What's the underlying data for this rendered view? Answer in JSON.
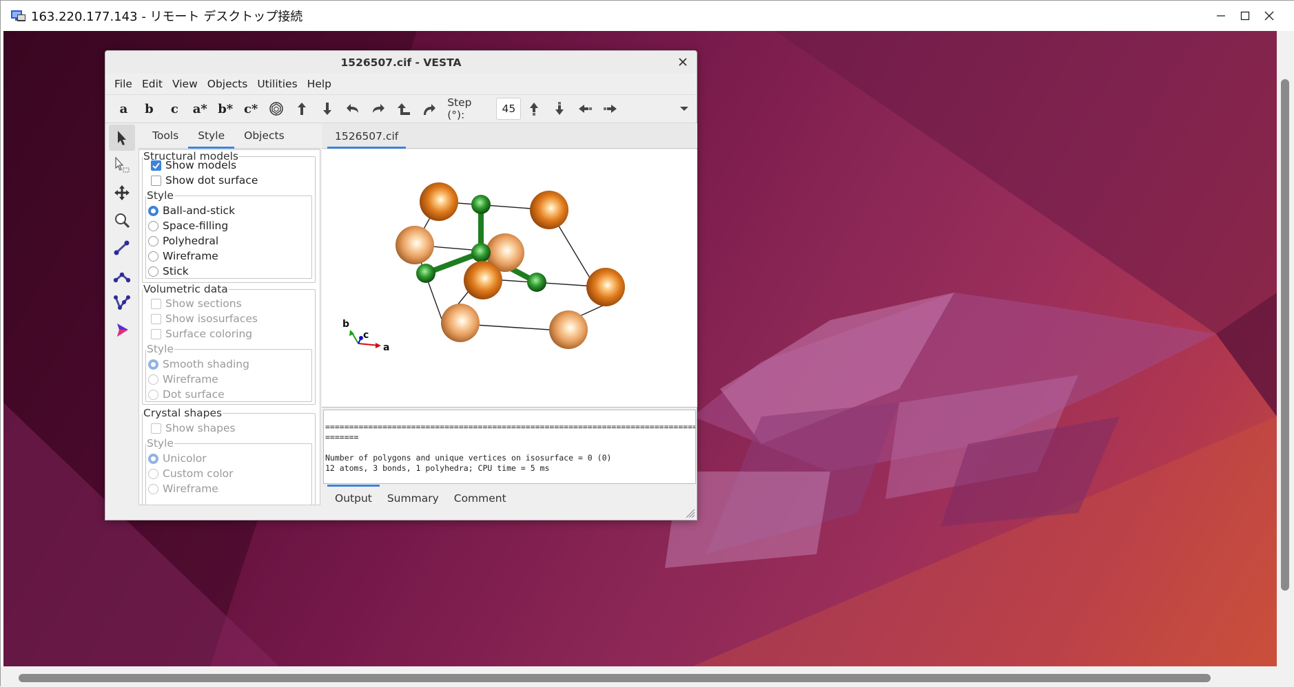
{
  "rdp": {
    "title": "163.220.177.143 - リモート デスクトップ接続"
  },
  "vesta": {
    "title": "1526507.cif - VESTA",
    "menu": [
      "File",
      "Edit",
      "View",
      "Objects",
      "Utilities",
      "Help"
    ],
    "toolbar": {
      "axis_buttons": [
        "a",
        "b",
        "c",
        "a*",
        "b*",
        "c*"
      ],
      "step_label": "Step (°):",
      "step_value": "45"
    },
    "left_tools": [
      "select-tool",
      "select-region-tool",
      "translate-tool",
      "magnify-tool",
      "distance-tool",
      "angle-tool",
      "dihedral-tool",
      "boundary-tool"
    ],
    "panel_tabs": [
      "Tools",
      "Style",
      "Objects"
    ],
    "panel_active_tab": "Style",
    "structural_models": {
      "legend": "Structural models",
      "show_models": "Show models",
      "show_dot_surface": "Show dot surface",
      "style_legend": "Style",
      "styles": [
        "Ball-and-stick",
        "Space-filling",
        "Polyhedral",
        "Wireframe",
        "Stick"
      ],
      "selected_style": "Ball-and-stick"
    },
    "volumetric": {
      "legend": "Volumetric data",
      "show_sections": "Show sections",
      "show_isosurfaces": "Show isosurfaces",
      "surface_coloring": "Surface coloring",
      "style_legend": "Style",
      "styles": [
        "Smooth shading",
        "Wireframe",
        "Dot surface"
      ],
      "selected_style": "Smooth shading"
    },
    "crystal_shapes": {
      "legend": "Crystal shapes",
      "show_shapes": "Show shapes",
      "style_legend": "Style",
      "styles": [
        "Unicolor",
        "Custom color",
        "Wireframe"
      ],
      "selected_style": "Unicolor"
    },
    "doc_tab": "1526507.cif",
    "axes": {
      "a": "a",
      "b": "b",
      "c": "c"
    },
    "output_lines": [
      "================================================================================",
      "=======",
      "",
      "Number of polygons and unique vertices on isosurface = 0 (0)",
      "12 atoms, 3 bonds, 1 polyhedra; CPU time = 5 ms"
    ],
    "bottom_tabs": [
      "Output",
      "Summary",
      "Comment"
    ],
    "bottom_active_tab": "Output",
    "colors": {
      "accent": "#3c83d9",
      "orange_atom": "#e07a1c",
      "green_atom": "#2f9a2f"
    }
  }
}
